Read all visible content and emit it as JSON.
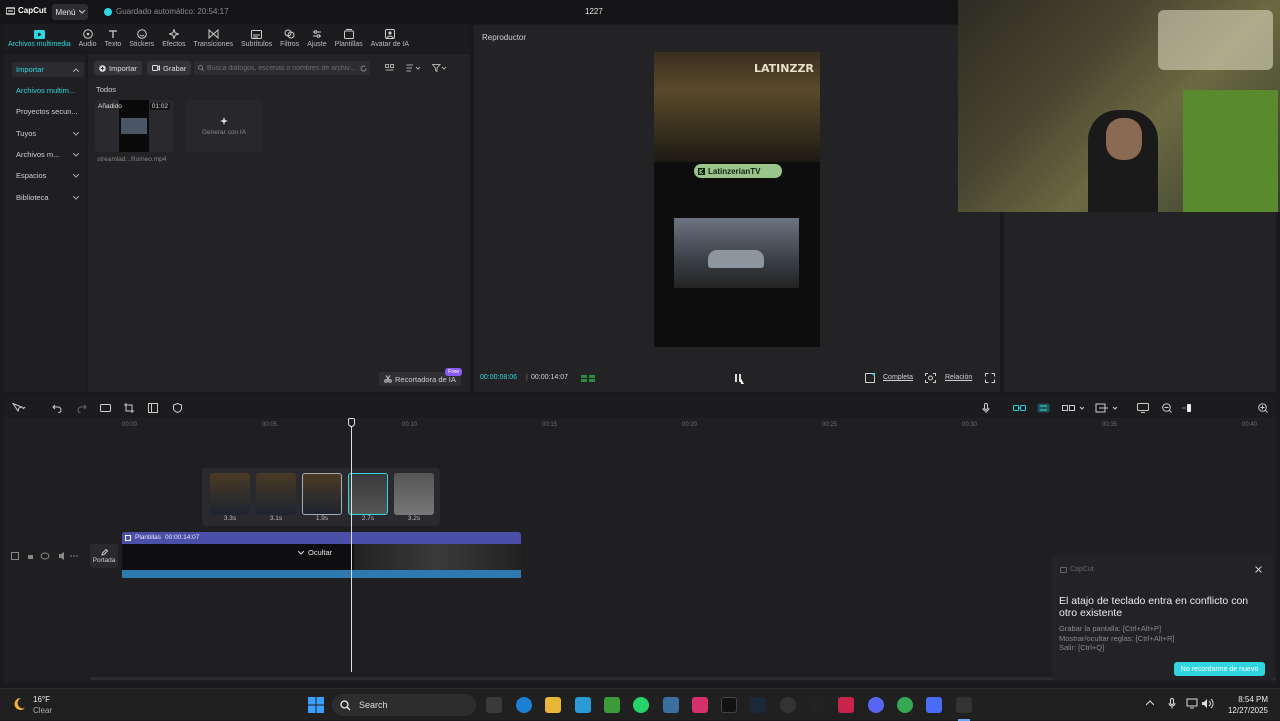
{
  "app": {
    "name": "CapCut",
    "menu_label": "Menú",
    "autosave": "Guardado automático: 20:54:17",
    "project_title": "1227"
  },
  "toolbar": {
    "items": [
      {
        "label": "Archivos multimedia",
        "icon": "media-icon"
      },
      {
        "label": "Audio",
        "icon": "audio-icon"
      },
      {
        "label": "Texto",
        "icon": "text-icon"
      },
      {
        "label": "Stickers",
        "icon": "sticker-icon"
      },
      {
        "label": "Efectos",
        "icon": "effects-icon"
      },
      {
        "label": "Transiciones",
        "icon": "transitions-icon"
      },
      {
        "label": "Subtítulos",
        "icon": "subtitles-icon"
      },
      {
        "label": "Filtros",
        "icon": "filters-icon"
      },
      {
        "label": "Ajuste",
        "icon": "adjust-icon"
      },
      {
        "label": "Plantillas",
        "icon": "templates-icon"
      },
      {
        "label": "Avatar de IA",
        "icon": "avatar-icon"
      }
    ]
  },
  "leftnav": {
    "items": [
      {
        "label": "Importar"
      },
      {
        "label": "Archivos multim..."
      },
      {
        "label": "Proyectos secun..."
      },
      {
        "label": "Tuyos"
      },
      {
        "label": "Archivos m..."
      },
      {
        "label": "Espacios"
      },
      {
        "label": "Biblioteca"
      }
    ]
  },
  "media": {
    "import_label": "Importar",
    "record_label": "Grabar",
    "search_placeholder": "Busca diálogos, escenas o nombres de archiv...",
    "section": "Todos",
    "clip": {
      "badge": "Añadido",
      "duration": "01:02",
      "name": "streamlad...Romeo.mp4"
    },
    "generate_label": "Generar con IA",
    "cutter_label": "Recortadora de IA",
    "free_badge": "Free"
  },
  "player": {
    "title": "Reproductor",
    "current_time": "00:00:08:06",
    "total_time": "00:00:14:07",
    "full_label": "Completa",
    "ratio_label": "Relación",
    "overlay_text": "LatinzerianTV",
    "wall_text": "LATINZZR"
  },
  "timeline": {
    "ruler": [
      "00:00",
      "00:05",
      "00:10",
      "00:15",
      "00:20",
      "00:25",
      "00:30",
      "00:35",
      "00:40"
    ],
    "clips": [
      {
        "duration": "3.3s"
      },
      {
        "duration": "3.1s"
      },
      {
        "duration": "1.9s"
      },
      {
        "duration": "2.7s"
      },
      {
        "duration": "3.2s"
      }
    ],
    "track_label": "Plantillas",
    "track_time": "00:00:14:07",
    "hide_label": "Ocultar",
    "cover_label": "Portada"
  },
  "popup": {
    "brand": "CapCut",
    "title": "El atajo de teclado entra en conflicto con otro existente",
    "lines": [
      "Grabar la pantalla: [Ctrl+Alt+P]",
      "Mostrar/ocultar reglas: [Ctrl+Alt+R]",
      "Salir: [Ctrl+Q]"
    ],
    "dismiss_label": "No recordarme de nuevo"
  },
  "taskbar": {
    "weather_temp": "16°F",
    "weather_desc": "Clear",
    "search_label": "Search",
    "time": "8:54 PM",
    "date": "12/27/2025"
  },
  "colors": {
    "accent": "#2fd6e0",
    "track": "#4a4fa8",
    "bg": "#1a1a1c"
  }
}
